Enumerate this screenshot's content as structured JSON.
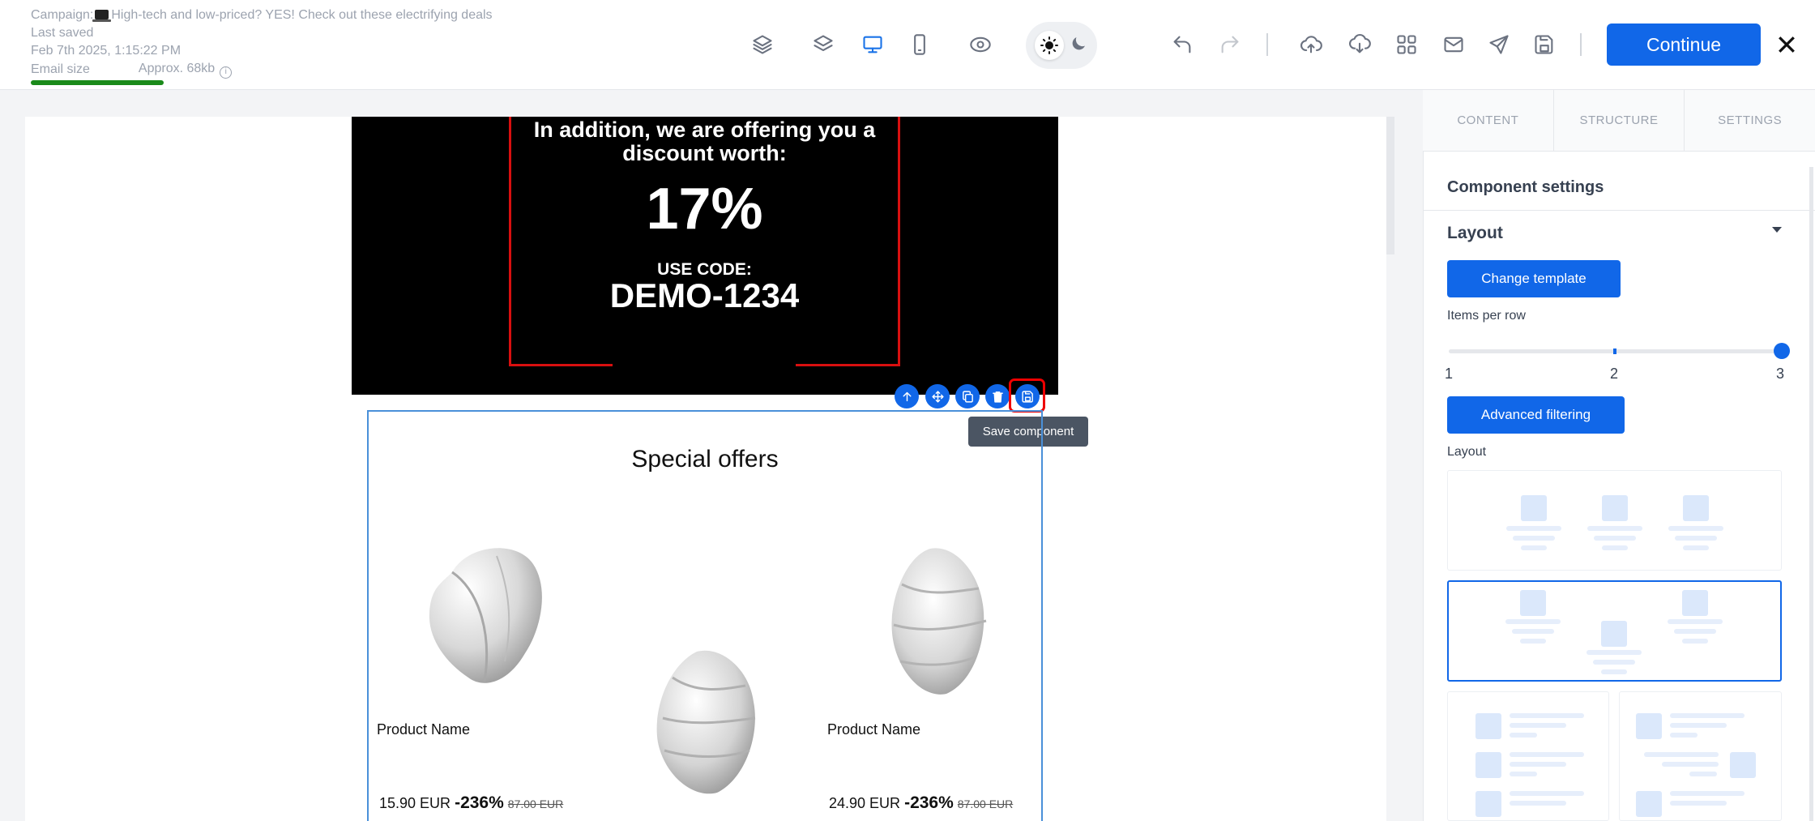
{
  "meta": {
    "campaign_prefix": "Campaign:",
    "campaign_title": "High-tech and low-priced? YES! Check out these electrifying deals",
    "last_saved_label": "Last saved",
    "last_saved_time": "Feb 7th 2025, 1:15:22 PM",
    "email_size_label": "Email size",
    "email_size_value": "Approx. 68kb",
    "email_size_fill": 0.3
  },
  "toolbar": {
    "icons": [
      "layers-outline-icon",
      "layers-icon",
      "desktop-icon",
      "mobile-icon",
      "eye-icon",
      "sun-icon",
      "moon-icon",
      "undo-icon",
      "redo-icon",
      "upload-icon",
      "download-icon",
      "grid-icon",
      "mail-icon",
      "send-icon",
      "save-icon",
      "close-icon"
    ],
    "continue_label": "Continue"
  },
  "banner": {
    "line1": "In addition, we are offering you a discount worth:",
    "percent": "17%",
    "code_label": "USE CODE:",
    "code": "DEMO-1234"
  },
  "component_controls": {
    "tooltip": "Save component"
  },
  "offers": {
    "title": "Special offers",
    "products": [
      {
        "name": "Product Name",
        "price": "15.90 EUR",
        "discount": "-236%",
        "old_price": "87.00 EUR"
      },
      {
        "name": "",
        "price": "",
        "discount": "",
        "old_price": ""
      },
      {
        "name": "Product Name",
        "price": "24.90 EUR",
        "discount": "-236%",
        "old_price": "87.00 EUR"
      }
    ]
  },
  "panel": {
    "tabs": [
      "CONTENT",
      "STRUCTURE",
      "SETTINGS"
    ],
    "heading": "Component settings",
    "section": "Layout",
    "change_template": "Change template",
    "items_per_row_label": "Items per row",
    "items_per_row_ticks": [
      "1",
      "2",
      "3"
    ],
    "items_per_row_value": 3,
    "advanced_filtering": "Advanced filtering",
    "layout_label": "Layout"
  }
}
